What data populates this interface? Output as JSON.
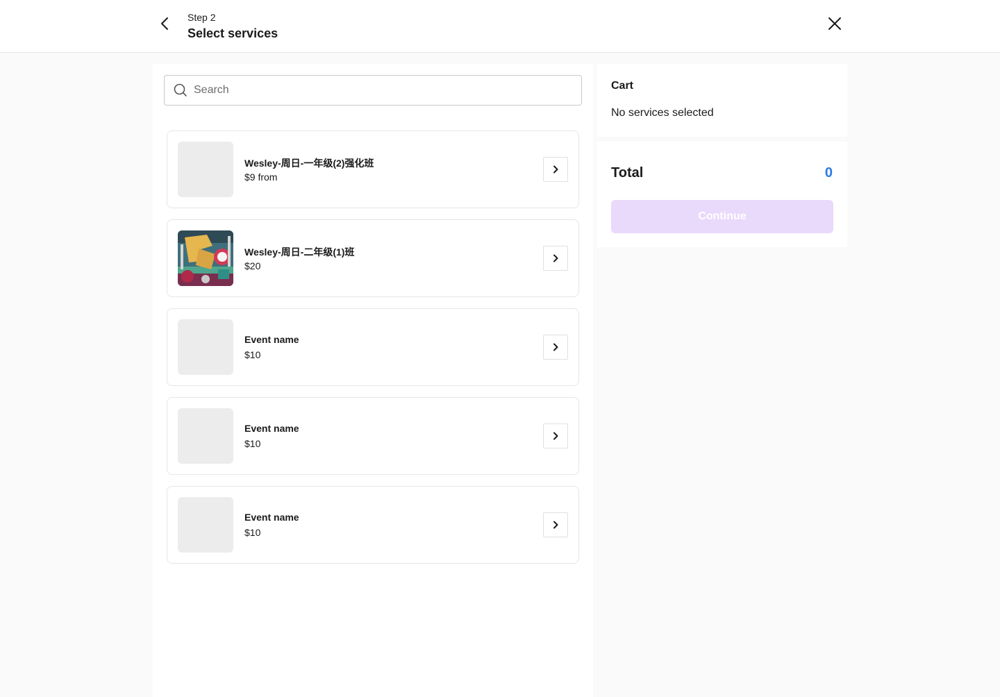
{
  "header": {
    "step": "Step 2",
    "title": "Select services"
  },
  "search": {
    "placeholder": "Search",
    "value": ""
  },
  "services": [
    {
      "name": "Wesley-周日-一年级(2)强化班",
      "price": "$9 from",
      "has_image": false
    },
    {
      "name": "Wesley-周日-二年级(1)班",
      "price": "$20",
      "has_image": true
    },
    {
      "name": "Event name",
      "price": "$10",
      "has_image": false
    },
    {
      "name": "Event name",
      "price": "$10",
      "has_image": false
    },
    {
      "name": "Event name",
      "price": "$10",
      "has_image": false
    }
  ],
  "cart": {
    "title": "Cart",
    "empty_text": "No services selected"
  },
  "summary": {
    "total_label": "Total",
    "total_value": "0",
    "continue_label": "Continue",
    "continue_disabled": true
  },
  "colors": {
    "accent_total": "#2d7ae6",
    "continue_disabled_bg": "#e9d9fb"
  },
  "icons": [
    "back-arrow-icon",
    "close-icon",
    "search-icon",
    "chevron-right-icon"
  ]
}
